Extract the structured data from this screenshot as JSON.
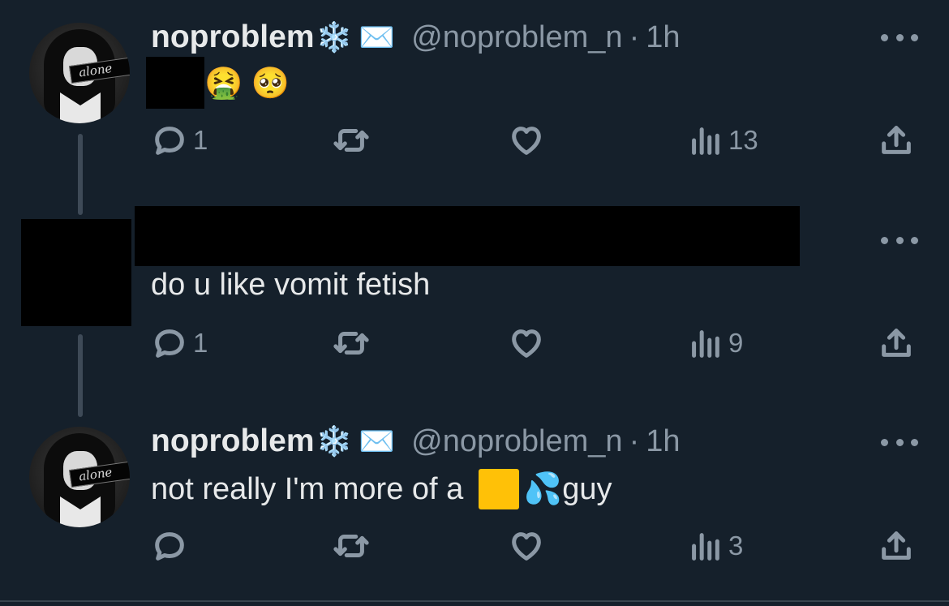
{
  "tweets": [
    {
      "display_name": "noproblem",
      "badges": [
        "❄️",
        "✉️"
      ],
      "handle": "@noproblem_n",
      "separator": "·",
      "time": "1h",
      "text": "🤮 🥺",
      "replies": "1",
      "retweets": "",
      "likes": "",
      "views": "13"
    },
    {
      "text": "do u like vomit fetish",
      "replies": "1",
      "retweets": "",
      "likes": "",
      "views": "9"
    },
    {
      "display_name": "noproblem",
      "badges": [
        "❄️",
        "✉️"
      ],
      "handle": "@noproblem_n",
      "separator": "·",
      "time": "1h",
      "text_before": "not really I'm more of a ",
      "text_emoji": "💦",
      "text_after": "guy",
      "replies": "",
      "retweets": "",
      "likes": "",
      "views": "3"
    }
  ],
  "avatar_text": "alone",
  "colors": {
    "background": "#15202b",
    "text": "#e7e9ea",
    "secondary": "#8b98a5",
    "square": "#ffc107"
  },
  "icons": [
    "reply-icon",
    "retweet-icon",
    "like-icon",
    "views-icon",
    "share-icon",
    "more-icon"
  ]
}
